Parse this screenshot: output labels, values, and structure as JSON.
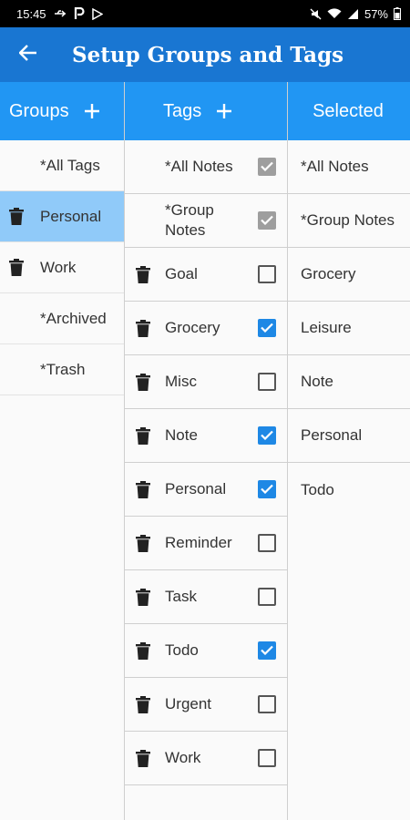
{
  "status": {
    "time": "15:45",
    "battery": "57%"
  },
  "appbar": {
    "title": "Setup Groups and Tags"
  },
  "groups": {
    "header": "Groups",
    "items": [
      {
        "label": "*All Tags",
        "deletable": false,
        "selected": false
      },
      {
        "label": "Personal",
        "deletable": true,
        "selected": true
      },
      {
        "label": "Work",
        "deletable": true,
        "selected": false
      },
      {
        "label": "*Archived",
        "deletable": false,
        "selected": false
      },
      {
        "label": "*Trash",
        "deletable": false,
        "selected": false
      }
    ]
  },
  "tags": {
    "header": "Tags",
    "items": [
      {
        "label": "*All Notes",
        "deletable": false,
        "state": "disabled"
      },
      {
        "label": "*Group Notes",
        "deletable": false,
        "state": "disabled"
      },
      {
        "label": "Goal",
        "deletable": true,
        "state": "unchecked"
      },
      {
        "label": "Grocery",
        "deletable": true,
        "state": "checked"
      },
      {
        "label": "Misc",
        "deletable": true,
        "state": "unchecked"
      },
      {
        "label": "Note",
        "deletable": true,
        "state": "checked"
      },
      {
        "label": "Personal",
        "deletable": true,
        "state": "checked"
      },
      {
        "label": "Reminder",
        "deletable": true,
        "state": "unchecked"
      },
      {
        "label": "Task",
        "deletable": true,
        "state": "unchecked"
      },
      {
        "label": "Todo",
        "deletable": true,
        "state": "checked"
      },
      {
        "label": "Urgent",
        "deletable": true,
        "state": "unchecked"
      },
      {
        "label": "Work",
        "deletable": true,
        "state": "unchecked"
      }
    ]
  },
  "selected": {
    "header": "Selected",
    "items": [
      "*All Notes",
      "*Group Notes",
      "Grocery",
      "Leisure",
      "Note",
      "Personal",
      "Todo"
    ]
  },
  "colors": {
    "appbar": "#1976d2",
    "header": "#2196f3",
    "selected_row": "#90caf9",
    "checkbox": "#1e88e5"
  }
}
